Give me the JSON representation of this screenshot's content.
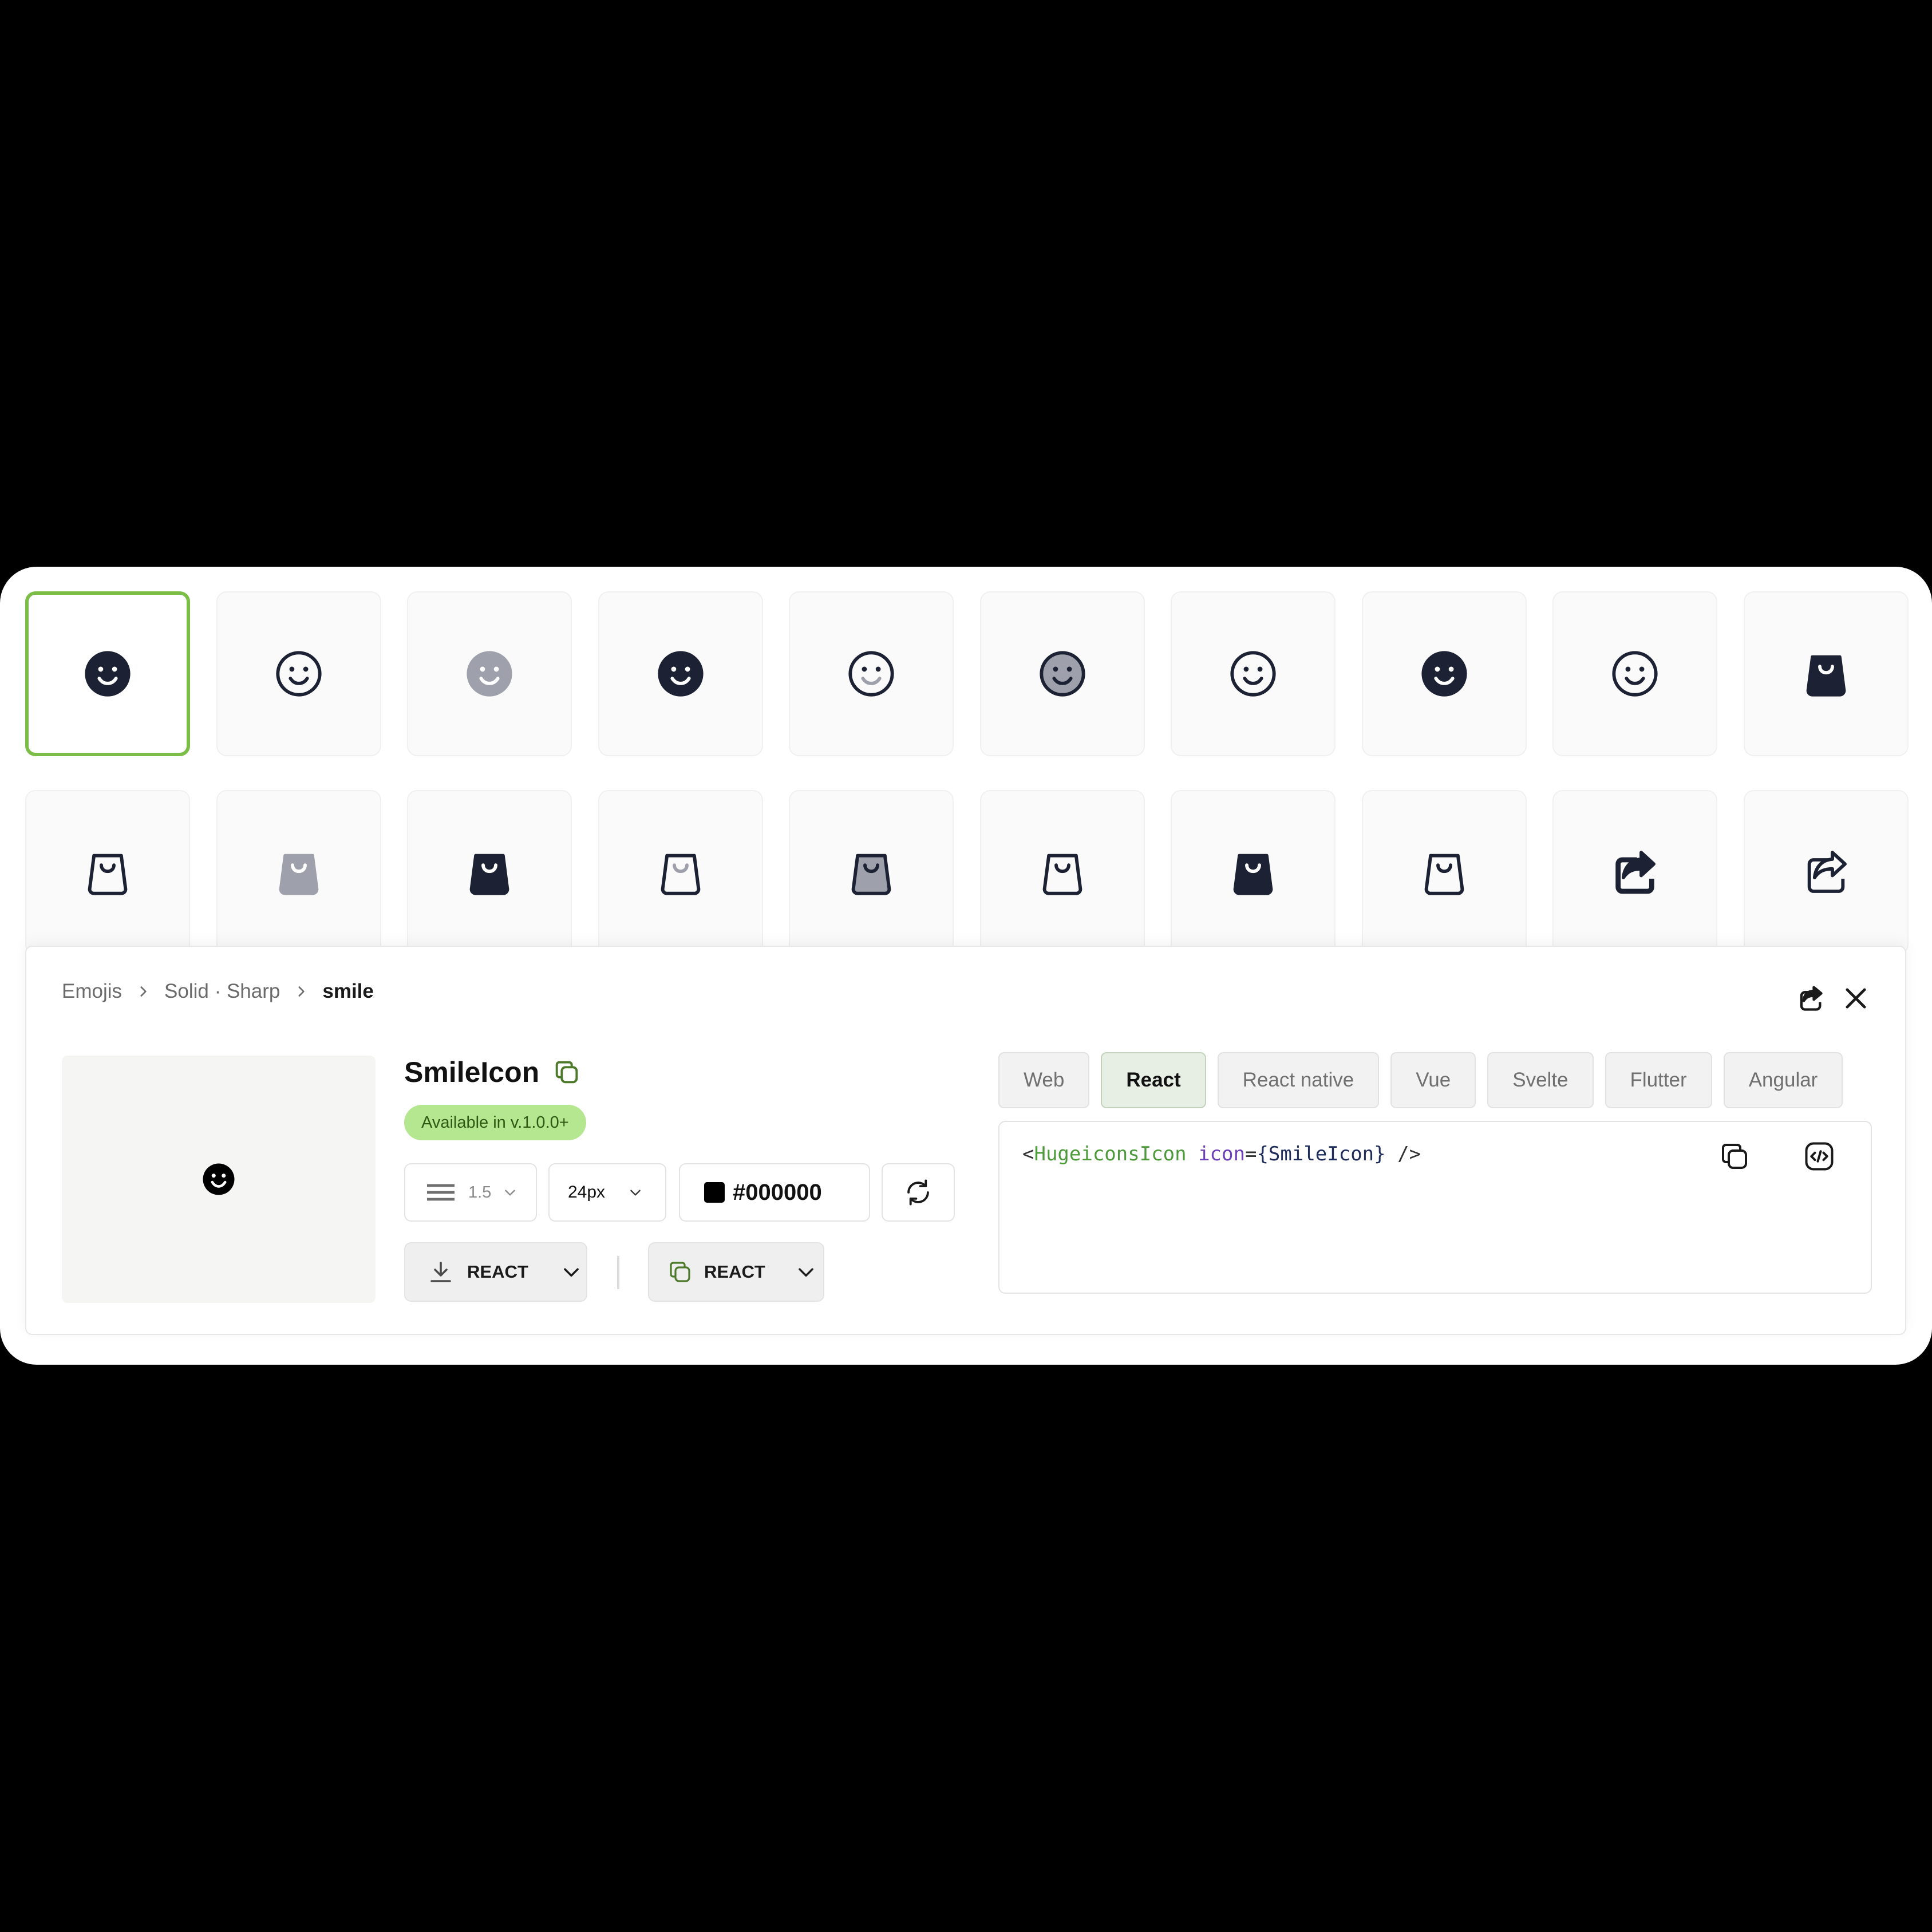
{
  "grid": {
    "rows": [
      [
        {
          "icon": "smile-solid-icon",
          "variant": "solid",
          "color": "#1c2133",
          "selected": true
        },
        {
          "icon": "smile-stroke-icon",
          "variant": "stroke",
          "color": "#1c2133"
        },
        {
          "icon": "smile-duotone-icon",
          "variant": "duotone",
          "color": "#9ea1ab"
        },
        {
          "icon": "smile-solid-icon",
          "variant": "solid",
          "color": "#1c2133"
        },
        {
          "icon": "smile-twotone-icon",
          "variant": "twotone",
          "color": "#1c2133"
        },
        {
          "icon": "smile-bulk-icon",
          "variant": "bulk",
          "color": "#9ea1ab"
        },
        {
          "icon": "smile-stroke-icon",
          "variant": "stroke",
          "color": "#1c2133"
        },
        {
          "icon": "smile-solid-icon",
          "variant": "solid",
          "color": "#1c2133"
        },
        {
          "icon": "smile-stroke-icon",
          "variant": "stroke",
          "color": "#1c2133"
        },
        {
          "icon": "shopping-bag-solid-icon",
          "variant": "solid",
          "color": "#1c2133"
        }
      ],
      [
        {
          "icon": "shopping-bag-stroke-icon",
          "variant": "stroke",
          "color": "#1c2133"
        },
        {
          "icon": "shopping-bag-duotone-icon",
          "variant": "duotone",
          "color": "#9ea1ab"
        },
        {
          "icon": "shopping-bag-solid-icon",
          "variant": "solid",
          "color": "#1c2133"
        },
        {
          "icon": "shopping-bag-twotone-icon",
          "variant": "twotone",
          "color": "#1c2133"
        },
        {
          "icon": "shopping-bag-bulk-icon",
          "variant": "bulk",
          "color": "#9ea1ab"
        },
        {
          "icon": "shopping-bag-stroke-icon",
          "variant": "stroke",
          "color": "#1c2133"
        },
        {
          "icon": "shopping-bag-solid-icon",
          "variant": "solid",
          "color": "#1c2133"
        },
        {
          "icon": "shopping-bag-stroke-icon",
          "variant": "stroke",
          "color": "#1c2133"
        },
        {
          "icon": "share-solid-icon",
          "variant": "solid",
          "color": "#1c2133"
        },
        {
          "icon": "share-stroke-icon",
          "variant": "stroke",
          "color": "#1c2133"
        }
      ]
    ]
  },
  "detail": {
    "breadcrumb": {
      "category": "Emojis",
      "style": "Solid · Sharp",
      "current": "smile"
    },
    "actions": {
      "share_icon": "share-icon",
      "close_icon": "close-icon"
    },
    "icon_name": "SmileIcon",
    "badge": "Available in v.1.0.0+",
    "stroke_width": "1.5",
    "size": "24px",
    "color": "#000000",
    "download_label": "REACT",
    "copy_label": "REACT",
    "tabs": [
      {
        "label": "Web",
        "active": false
      },
      {
        "label": "React",
        "active": true
      },
      {
        "label": "React native",
        "active": false
      },
      {
        "label": "Vue",
        "active": false
      },
      {
        "label": "Svelte",
        "active": false
      },
      {
        "label": "Flutter",
        "active": false
      },
      {
        "label": "Angular",
        "active": false
      }
    ],
    "code": {
      "open": "<",
      "tag": "HugeiconsIcon",
      "attr": "icon",
      "eq": "=",
      "value": "{SmileIcon}",
      "close": " />"
    }
  },
  "colors": {
    "accent": "#7cbd47",
    "badge_bg": "#b5e690",
    "icon_dark": "#1c2133",
    "icon_grey": "#9ea1ab"
  }
}
